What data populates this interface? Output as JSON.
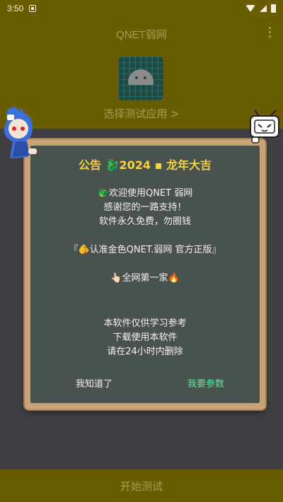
{
  "status_bar": {
    "time": "3:50"
  },
  "app": {
    "title": "QNET弱网",
    "select_app": "选择测试应用 >",
    "start_test": "开始测试"
  },
  "dialog": {
    "title": "公告 🐉2024 ▪ 龙年大吉",
    "lines": [
      "🐲欢迎使用QNET 弱网",
      "感谢您的一路支持！",
      "软件永久免费，勿圈钱",
      "『🫵认准金色QNET.弱网 官方正版』",
      "👆🏻全网第一家🔥",
      "本软件仅供学习参考",
      "下载使用本软件",
      "请在24小时内删除"
    ],
    "button_ok": "我知道了",
    "button_params": "我要参数"
  },
  "colors": {
    "status_bg": "#6b5c00",
    "dialog_title": "#f4d240",
    "params_button": "#5de6a0",
    "board_frame": "#c8a37a",
    "board_bg": "#4a524e"
  }
}
